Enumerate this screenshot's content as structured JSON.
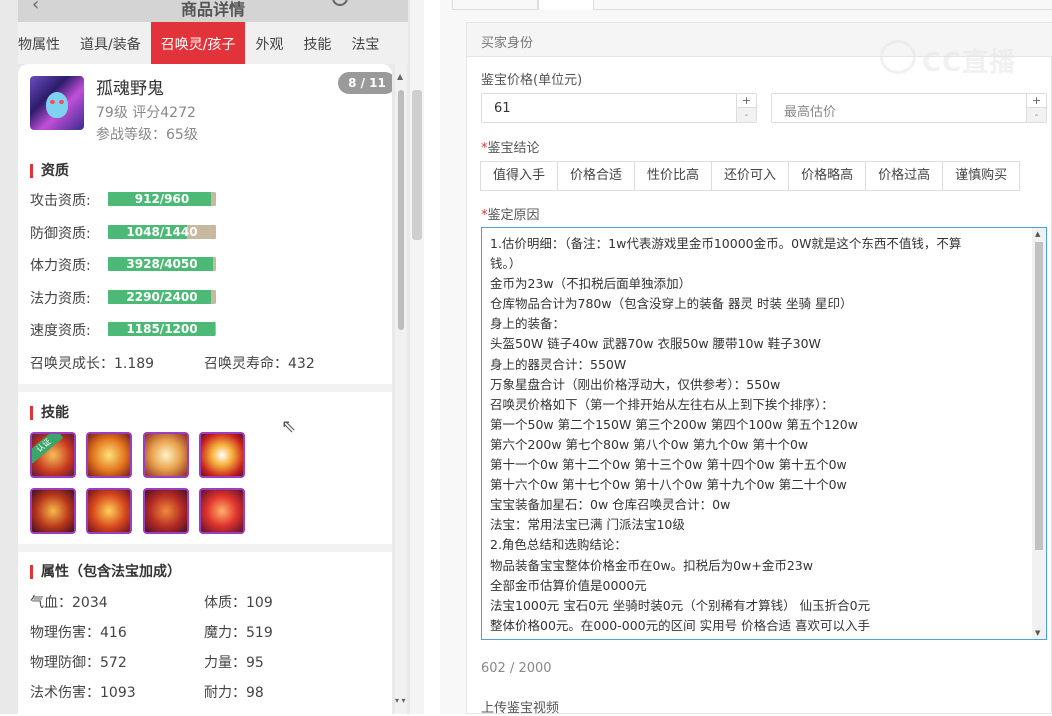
{
  "phone": {
    "header_title": "商品详情",
    "tabs": [
      {
        "label": "物属性"
      },
      {
        "label": "道具/装备"
      },
      {
        "label": "召唤灵/孩子",
        "active": true
      },
      {
        "label": "外观"
      },
      {
        "label": "技能"
      },
      {
        "label": "法宝"
      }
    ],
    "pet": {
      "name": "孤魂野鬼",
      "level_score": "79级 评分4272",
      "battle_level": "参战等级：65级",
      "page_badge": "8 / 11"
    },
    "aptitude": {
      "title": "资质",
      "items": [
        {
          "label": "攻击资质:",
          "text": "912/960",
          "fraction": 0.95
        },
        {
          "label": "防御资质:",
          "text": "1048/1440",
          "fraction": 0.7278
        },
        {
          "label": "体力资质:",
          "text": "3928/4050",
          "fraction": 0.9699
        },
        {
          "label": "法力资质:",
          "text": "2290/2400",
          "fraction": 0.9542
        },
        {
          "label": "速度资质:",
          "text": "1185/1200",
          "fraction": 0.9875
        }
      ],
      "growth": "召唤灵成长：1.189",
      "lifespan": "召唤灵寿命：432"
    },
    "skills": {
      "title": "技能",
      "certified_tag": "认证",
      "icons": [
        "skill-icon-certified",
        "skill-icon-fire-orb",
        "skill-icon-rabbit",
        "skill-icon-lightning",
        "skill-icon-demon-face",
        "skill-icon-flame-claw",
        "skill-icon-rage-face",
        "skill-icon-fire-swirl"
      ]
    },
    "attributes": {
      "title": "属性（包含法宝加成）",
      "left": [
        "气血：2034",
        "物理伤害：416",
        "物理防御：572",
        "法术伤害：1093"
      ],
      "right": [
        "体质：109",
        "魔力：519",
        "力量：95",
        "耐力：98"
      ]
    }
  },
  "form": {
    "section": "买家身份",
    "price_label": "鉴宝价格(单位元)",
    "price_value": "61",
    "max_price_placeholder": "最高估价",
    "conclusion_label": "鉴宝结论",
    "conclusion_options": [
      "值得入手",
      "价格合适",
      "性价比高",
      "还价可入",
      "价格略高",
      "价格过高",
      "谨慎购买"
    ],
    "reason_label": "鉴定原因",
    "reason_lines": [
      "1.估价明细：（备注：1w代表游戏里金币10000金币。0W就是这个东西不值钱，不算",
      "钱。）",
      "金币为23w（不扣税后面单独添加）",
      "仓库物品合计为780w（包含没穿上的装备 器灵 时装 坐骑 星印）",
      "身上的装备：",
      "头盔50W 链子40w 武器70w 衣服50w 腰带10w 鞋子30W",
      "身上的器灵合计：550W",
      "万象星盘合计（刚出价格浮动大，仅供参考）：550w",
      "召唤灵价格如下（第一个排开始从左往右从上到下挨个排序）：",
      "第一个50w 第二个150W  第三个200w  第四个100w  第五个120w",
      "第六个200w  第七个80w  第八个0w   第九个0w  第十个0w",
      "第十一个0w 第十二个0w 第十三个0w 第十四个0w  第十五个0w",
      "第十六个0w 第十七个0w 第十八个0w 第十九个0w  第二十个0w",
      "宝宝装备加星石：0w     仓库召唤灵合计：0w",
      "法宝：常用法宝已满 门派法宝10级",
      "2.角色总结和选购结论：",
      "物品装备宝宝整体价格金币在0w。扣税后为0w+金币23w",
      "全部金币估算价值是0000元",
      "法宝1000元 宝石0元  坐骑时装0元（个别稀有才算钱） 仙玉折合0元",
      "整体价格00元。在000-000元的区间 实用号 价格合适 喜欢可以入手"
    ],
    "counter": "602 / 2000",
    "upload_label": "上传鉴宝视频"
  },
  "watermark": "CC直播",
  "colors": {
    "accent": "#e2333b",
    "bar_fill": "#4cb976",
    "bar_rest": "#c9b8a0",
    "focus_border": "#4aa3df"
  }
}
